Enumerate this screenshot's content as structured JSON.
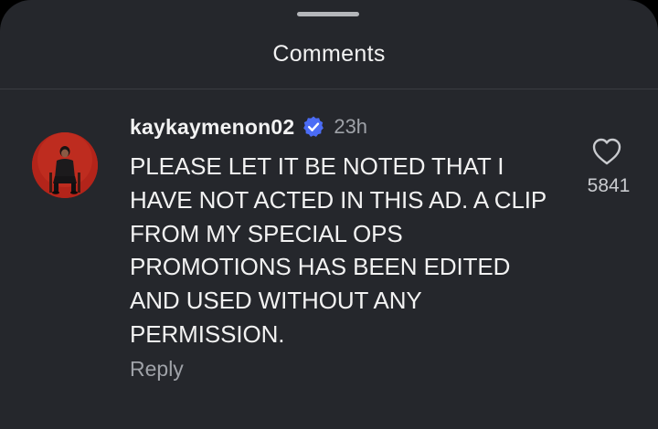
{
  "sheet": {
    "title": "Comments"
  },
  "comment": {
    "username": "kaykaymenon02",
    "verified": true,
    "timestamp": "23h",
    "text": "PLEASE LET IT BE NOTED THAT I HAVE NOT ACTED IN THIS AD. A CLIP FROM MY SPECIAL OPS PROMOTIONS HAS BEEN EDITED AND USED WITHOUT ANY PERMISSION.",
    "reply_label": "Reply",
    "like_count": "5841",
    "like_icon": "heart-outline-icon",
    "verified_icon": "verified-badge-icon"
  },
  "colors": {
    "sheet_background": "#25272c",
    "primary_text": "#f2f2f2",
    "secondary_text": "#9fa2a8",
    "verified_badge": "#4b6cf5",
    "avatar_background": "#b3241a"
  }
}
